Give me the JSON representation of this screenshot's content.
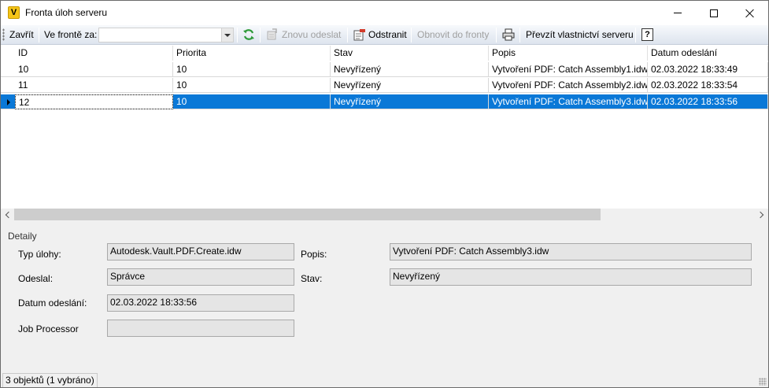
{
  "window": {
    "title": "Fronta úloh serveru",
    "app_icon_letter": "V"
  },
  "toolbar": {
    "close_label": "Zavřít",
    "queue_label": "Ve frontě za:",
    "queue_value": "",
    "resubmit_label": "Znovu odeslat",
    "remove_label": "Odstranit",
    "requeue_label": "Obnovit do fronty",
    "take_ownership_label": "Převzít vlastnictví serveru",
    "help_label": "?"
  },
  "grid": {
    "columns": [
      "ID",
      "Priorita",
      "Stav",
      "Popis",
      "Datum odeslání"
    ],
    "rows": [
      {
        "id": "10",
        "priority": "10",
        "status": "Nevyřízený",
        "description": "Vytvoření PDF: Catch Assembly1.idw",
        "date": "02.03.2022 18:33:49",
        "selected": false
      },
      {
        "id": "11",
        "priority": "10",
        "status": "Nevyřízený",
        "description": "Vytvoření PDF: Catch Assembly2.idw",
        "date": "02.03.2022 18:33:54",
        "selected": false
      },
      {
        "id": "12",
        "priority": "10",
        "status": "Nevyřízený",
        "description": "Vytvoření PDF: Catch Assembly3.idw",
        "date": "02.03.2022 18:33:56",
        "selected": true
      }
    ]
  },
  "details": {
    "title": "Detaily",
    "job_type_label": "Typ úlohy:",
    "job_type_value": "Autodesk.Vault.PDF.Create.idw",
    "submitted_by_label": "Odeslal:",
    "submitted_by_value": "Správce",
    "submitted_date_label": "Datum odeslání:",
    "submitted_date_value": "02.03.2022 18:33:56",
    "job_processor_label": "Job Processor",
    "job_processor_value": "",
    "description_label": "Popis:",
    "description_value": "Vytvoření PDF: Catch Assembly3.idw",
    "status_label": "Stav:",
    "status_value": "Nevyřízený"
  },
  "statusbar": {
    "text": "3 objektů (1 vybráno)"
  },
  "colors": {
    "selection": "#0a78d7",
    "refresh_icon": "#2e9a3a",
    "remove_icon": "#d23b2b"
  }
}
